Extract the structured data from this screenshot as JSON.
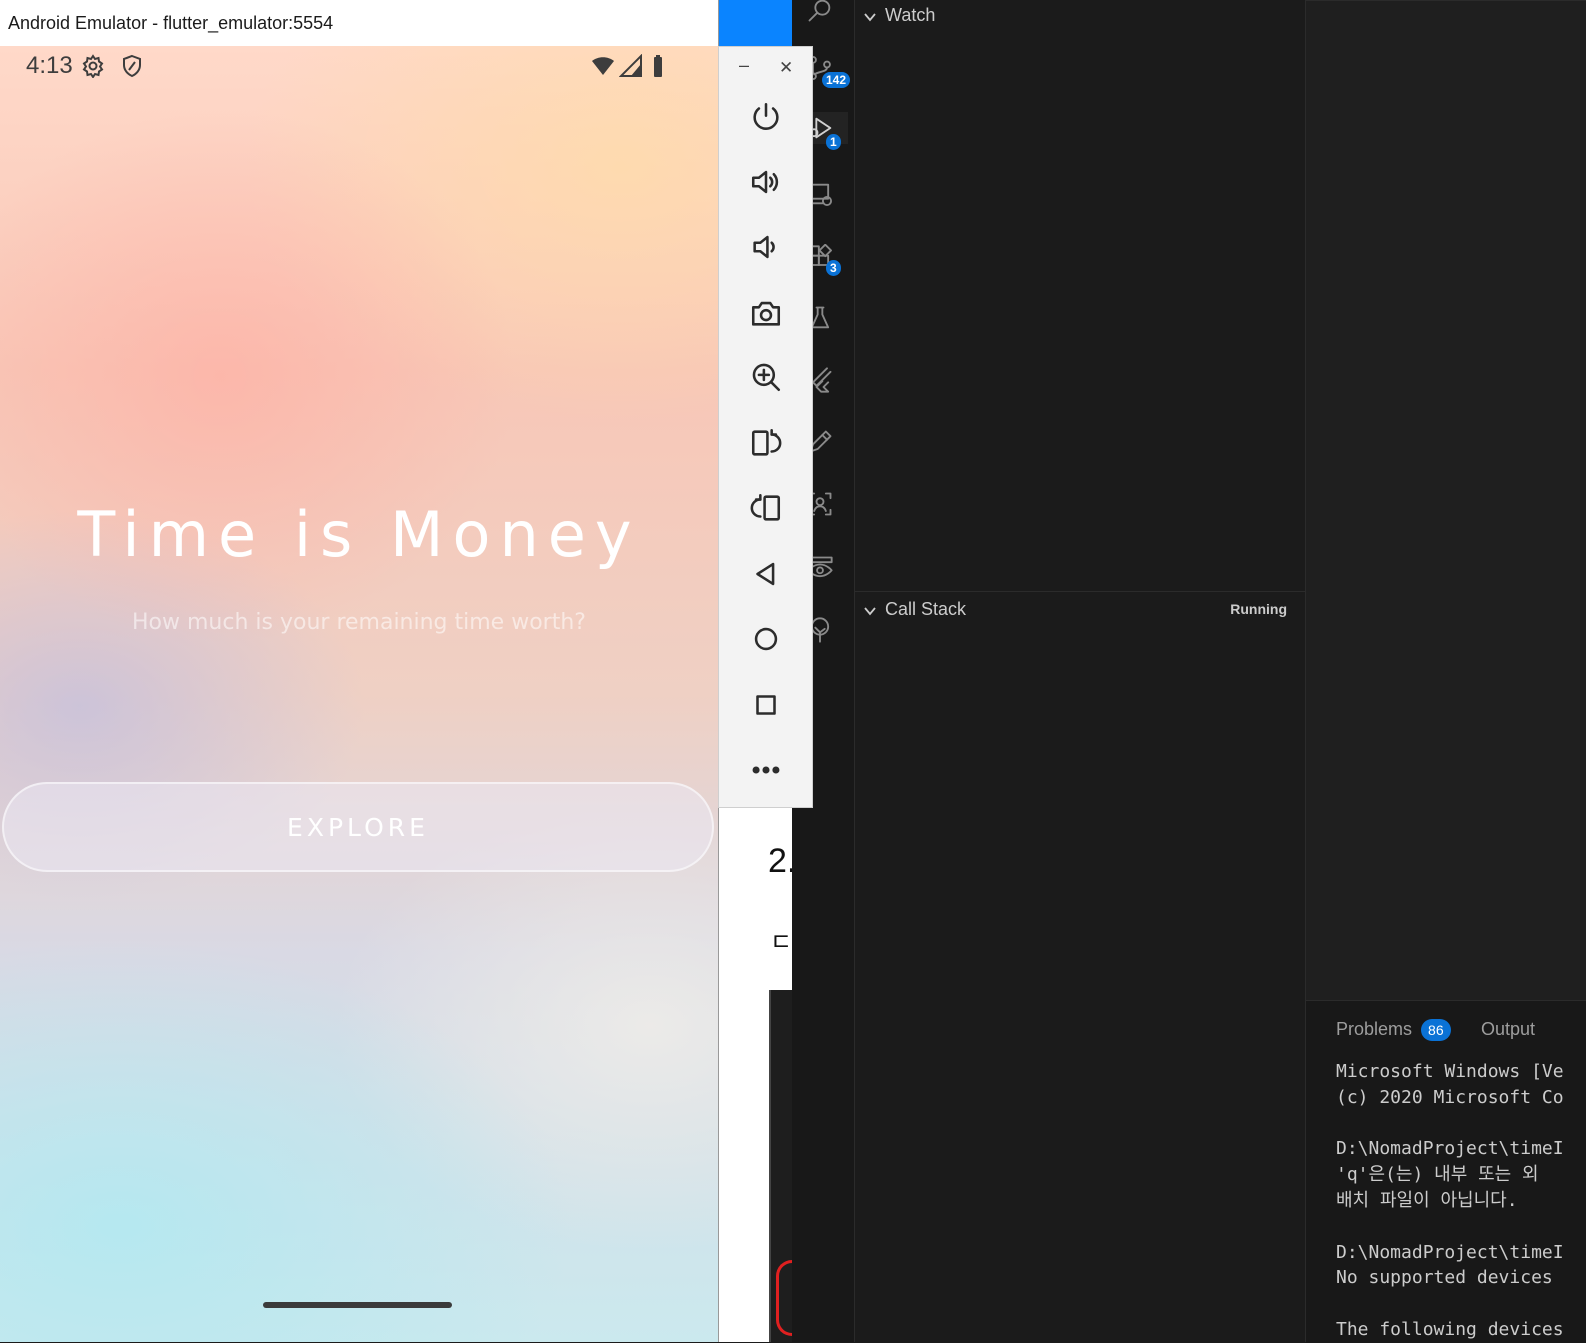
{
  "emulator": {
    "window_title": "Android Emulator - flutter_emulator:5554",
    "status_time": "4:13",
    "app": {
      "title": "Time is Money",
      "subtitle": "How much is your remaining time worth?",
      "explore_label": "EXPLORE"
    },
    "toolbar": {
      "minimize_glyph": "–",
      "close_glyph": "✕",
      "buttons": [
        "power-icon",
        "volume-up-icon",
        "volume-down-icon",
        "camera-icon",
        "zoom-in-icon",
        "rotate-left-icon",
        "rotate-right-icon",
        "back-icon",
        "home-icon",
        "overview-icon",
        "more-icon"
      ]
    }
  },
  "browser_sliver": {
    "heading_fragment": "2.",
    "text_fragment": "ㄷ"
  },
  "vscode": {
    "activity_badges": {
      "source_control": "142",
      "run_debug": "1",
      "extensions": "3"
    },
    "debug": {
      "watch_label": "Watch",
      "call_stack_label": "Call Stack",
      "call_stack_status": "Running"
    },
    "panel": {
      "problems_label": "Problems",
      "problems_count": "86",
      "output_label": "Output"
    },
    "terminal_lines": [
      "Microsoft Windows [Ve",
      "(c) 2020 Microsoft Co",
      "",
      "D:\\NomadProject\\timeI",
      "'q'은(는) 내부 또는 외",
      "배치 파일이 아닙니다.",
      "",
      "D:\\NomadProject\\timeI",
      "No supported devices ",
      "",
      "The following devices"
    ]
  },
  "colors": {
    "vscode_bg": "#1b1b1b",
    "badge": "#0a72d6",
    "browser_accent": "#0a84ff"
  }
}
